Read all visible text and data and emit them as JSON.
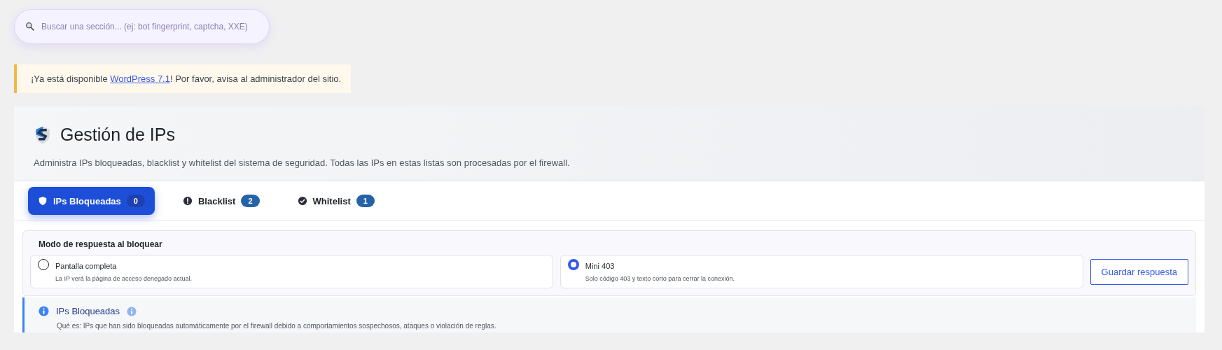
{
  "search": {
    "placeholder": "Buscar una sección... (ej: bot fingerprint, captcha, XXE)"
  },
  "notice": {
    "before": "¡Ya está disponible ",
    "link": "WordPress 7.1",
    "after": "! Por favor, avisa al administrador del sitio."
  },
  "page": {
    "title": "Gestión de IPs",
    "subtitle": "Administra IPs bloqueadas, blacklist y whitelist del sistema de seguridad. Todas las IPs en estas listas son procesadas por el firewall."
  },
  "tabs": [
    {
      "label": "IPs Bloqueadas",
      "count": "0",
      "selected": true
    },
    {
      "label": "Blacklist",
      "count": "2",
      "selected": false
    },
    {
      "label": "Whitelist",
      "count": "1",
      "selected": false
    }
  ],
  "response_mode": {
    "title": "Modo de respuesta al bloquear",
    "options": [
      {
        "label": "Pantalla completa",
        "description": "La IP verá la página de acceso denegado actual.",
        "selected": false
      },
      {
        "label": "Mini 403",
        "description": "Solo código 403 y texto corto para cerrar la conexión.",
        "selected": true
      }
    ],
    "save_button": "Guardar respuesta"
  },
  "info": {
    "title": "IPs Bloqueadas",
    "description": "Qué es: IPs que han sido bloqueadas automáticamente por el firewall debido a comportamientos sospechosos, ataques o violación de reglas."
  }
}
